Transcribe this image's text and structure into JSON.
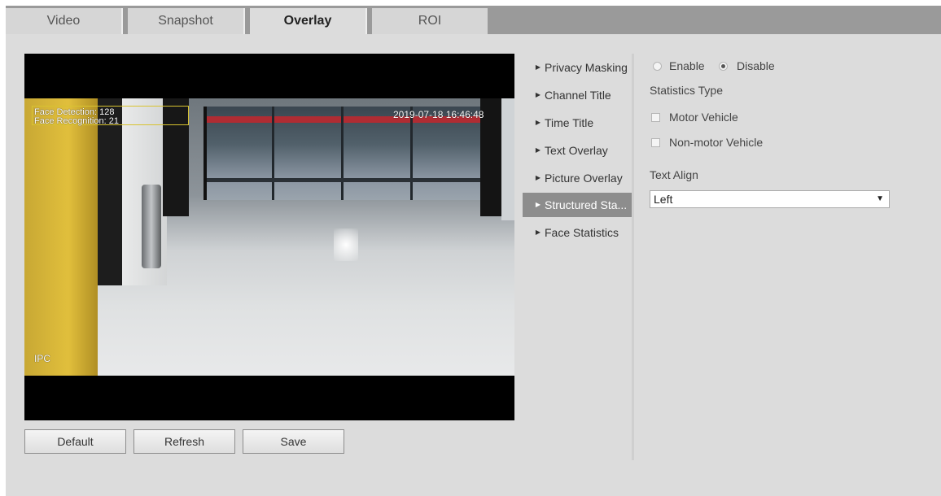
{
  "tabs": [
    {
      "label": "Video",
      "active": false
    },
    {
      "label": "Snapshot",
      "active": false
    },
    {
      "label": "Overlay",
      "active": true
    },
    {
      "label": "ROI",
      "active": false
    }
  ],
  "preview": {
    "osd_face_line1": "Face Detection: 128",
    "osd_face_line2": "Face Recognition: 21",
    "osd_timestamp": "2019-07-18 16:46:48",
    "osd_channel": "IPC"
  },
  "buttons": {
    "default_label": "Default",
    "refresh_label": "Refresh",
    "save_label": "Save"
  },
  "menu": {
    "items": [
      {
        "label": "Privacy Masking",
        "active": false
      },
      {
        "label": "Channel Title",
        "active": false
      },
      {
        "label": "Time Title",
        "active": false
      },
      {
        "label": "Text Overlay",
        "active": false
      },
      {
        "label": "Picture Overlay",
        "active": false
      },
      {
        "label": "Structured Sta...",
        "active": true
      },
      {
        "label": "Face Statistics",
        "active": false
      }
    ]
  },
  "settings": {
    "enable_label": "Enable",
    "disable_label": "Disable",
    "selected_mode": "Disable",
    "statistics_type_label": "Statistics Type",
    "motor_vehicle_label": "Motor Vehicle",
    "motor_vehicle_checked": false,
    "non_motor_vehicle_label": "Non-motor Vehicle",
    "non_motor_vehicle_checked": false,
    "text_align_label": "Text Align",
    "text_align_value": "Left"
  },
  "colors": {
    "panel_bg": "#dcdcdc",
    "tabbar_bg": "#9a9a9a",
    "menu_active_bg": "#8d8d8d",
    "osd_box": "#d8c330"
  }
}
